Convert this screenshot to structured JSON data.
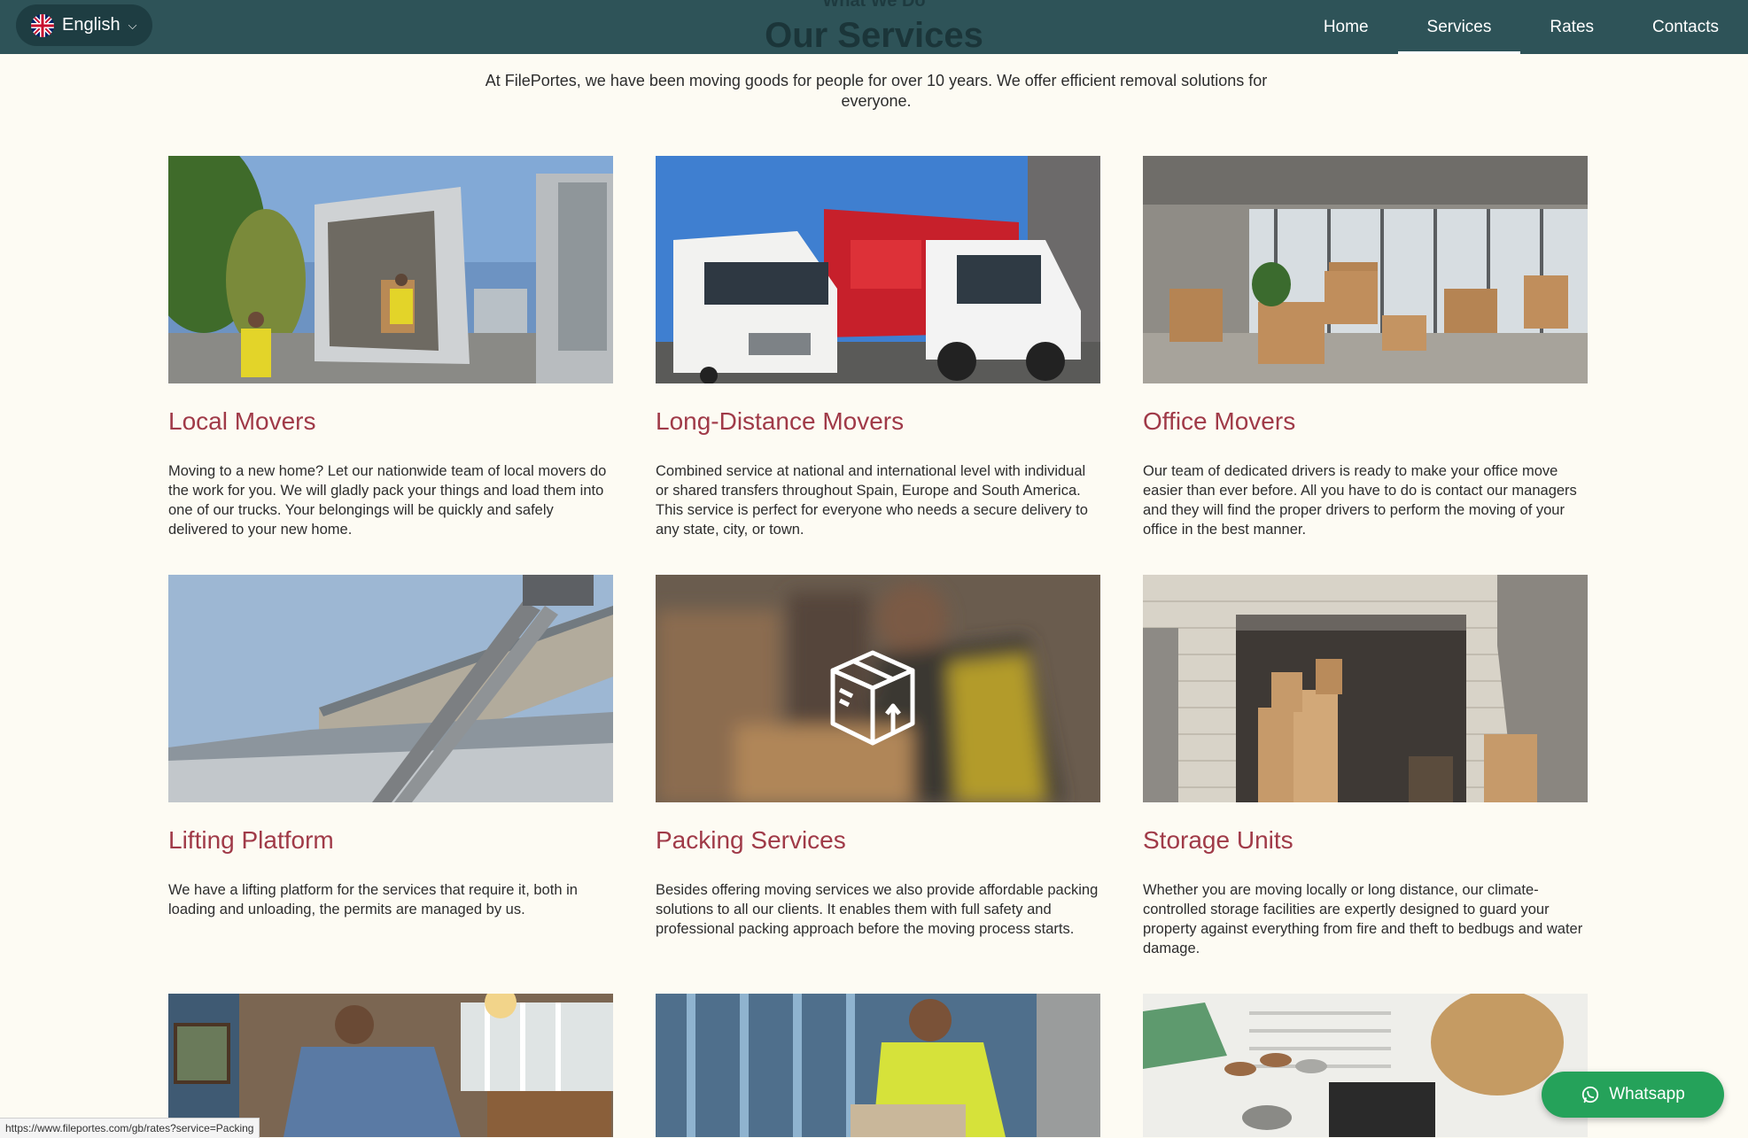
{
  "header": {
    "language": "English",
    "kicker": "What We Do",
    "title": "Our Services",
    "nav": [
      "Home",
      "Services",
      "Rates",
      "Contacts"
    ],
    "active_nav": "Services"
  },
  "intro": "At FilePortes, we have been moving goods for people for over 10 years. We offer efficient removal solutions for everyone.",
  "services": [
    {
      "title": "Local Movers",
      "text": "Moving to a new home? Let our nationwide team of local movers do the work for you. We will gladly pack your things and load them into one of our trucks. Your belongings will be quickly and safely delivered to your new home."
    },
    {
      "title": "Long-Distance Movers",
      "text": "Combined service at national and international level with individual or shared transfers throughout Spain, Europe and South America. This service is perfect for everyone who needs a secure delivery to any state, city, or town."
    },
    {
      "title": "Office Movers",
      "text": "Our team of dedicated drivers is ready to make your office move easier than ever before. All you have to do is contact our managers and they will find the proper drivers to perform the moving of your office in the best manner."
    },
    {
      "title": "Lifting Platform",
      "text": "We have a lifting platform for the services that require it, both in loading and unloading, the permits are managed by us."
    },
    {
      "title": "Packing Services",
      "text": "Besides offering moving services we also provide affordable packing solutions to all our clients. It enables them with full safety and professional packing approach before the moving process starts."
    },
    {
      "title": "Storage Units",
      "text": "Whether you are moving locally or long distance, our climate-controlled storage facilities are expertly designed to guard your property against everything from fire and theft to bedbugs and water damage."
    }
  ],
  "floating": {
    "whatsapp": "Whatsapp",
    "status_url": "https://www.fileportes.com/gb/rates?service=Packing"
  },
  "colors": {
    "header_bg": "#2e5358",
    "card_title": "#a03a48",
    "page_bg": "#fdfbf3",
    "whatsapp": "#25a25a"
  }
}
